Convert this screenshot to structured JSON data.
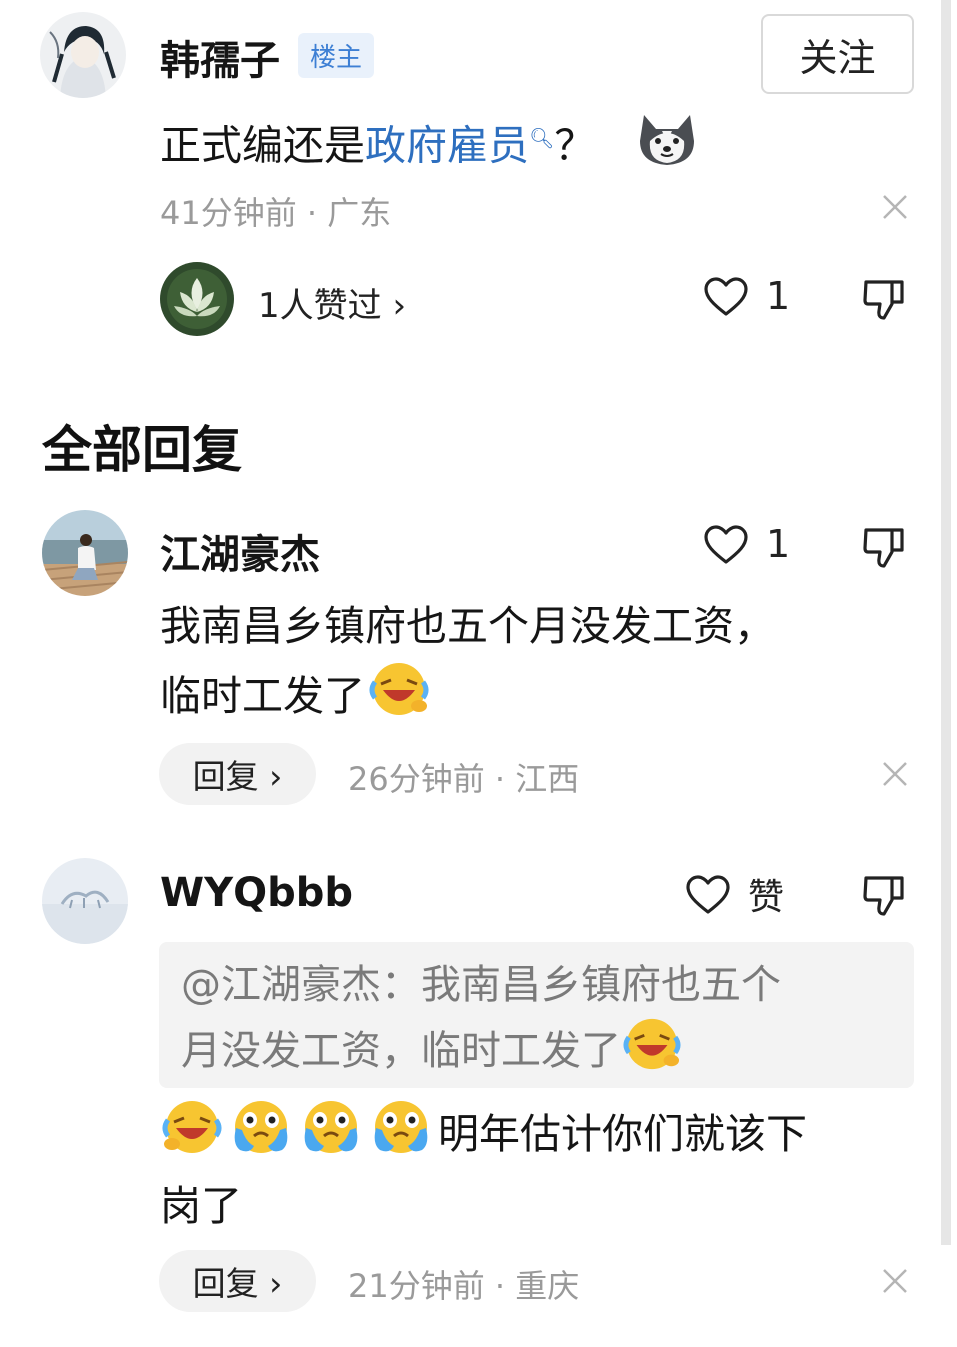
{
  "op": {
    "username": "韩孺子",
    "badge": "楼主",
    "follow_label": "关注",
    "text_before": "正式编还是",
    "text_link": "政府雇员",
    "text_after": "？",
    "meta": "41分钟前 · 广东",
    "liked_by": "1人赞过 ›",
    "like_count": "1"
  },
  "section_title": "全部回复",
  "replies": [
    {
      "username": "江湖豪杰",
      "like_count": "1",
      "line1": "我南昌乡镇府也五个月没发工资，",
      "line2": "临时工发了",
      "reply_label": "回复 ›",
      "meta": "26分钟前 · 江西"
    },
    {
      "username": "WYQbbb",
      "like_label": "赞",
      "quote_line1": "@江湖豪杰：我南昌乡镇府也五个",
      "quote_line2": "月没发工资，临时工发了",
      "line1": "明年估计你们就该下",
      "line2": "岗了",
      "reply_label": "回复 ›",
      "meta": "21分钟前 · 重庆"
    }
  ],
  "colors": {
    "link": "#2e6fbf",
    "meta": "#9a9a9a",
    "badge_bg": "#e9f1fb"
  },
  "icons": [
    "heart-outline-icon",
    "thumb-down-icon",
    "close-icon",
    "search-small-icon",
    "husky-sticker",
    "laughing-emoji",
    "crying-emoji"
  ]
}
